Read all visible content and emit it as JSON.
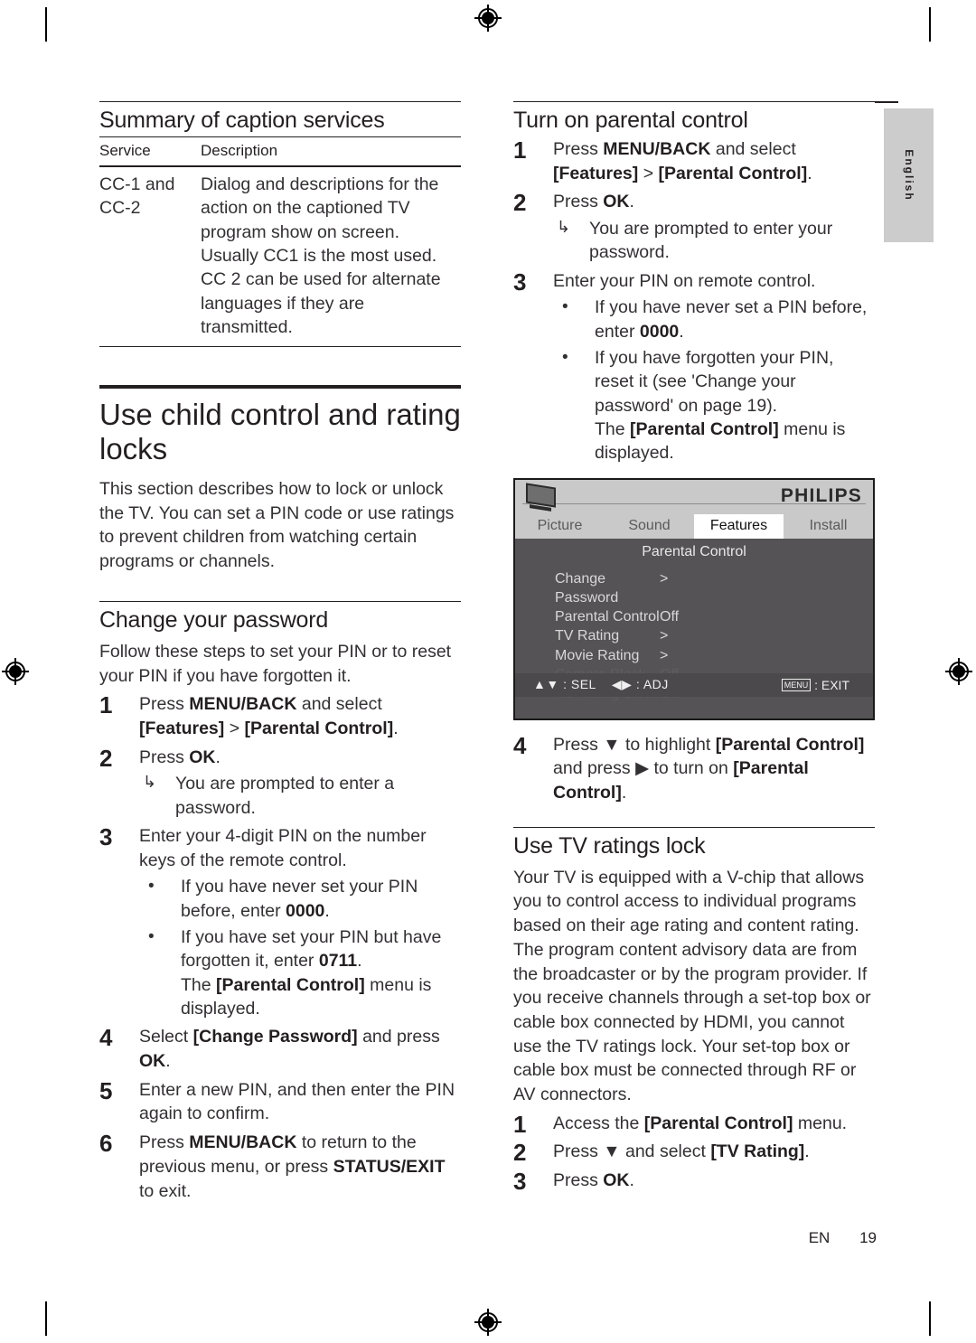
{
  "page": {
    "language_tab": "English",
    "footer_locale": "EN",
    "footer_page": "19"
  },
  "left_column": {
    "caption_section": {
      "heading": "Summary of caption services",
      "table": {
        "headers": [
          "Service",
          "Description"
        ],
        "rows": [
          {
            "service": "CC-1 and CC-2",
            "description": "Dialog and descriptions for the action on the captioned TV program show on screen. Usually CC1 is the most used. CC 2 can be used for alternate languages if they are transmitted."
          }
        ]
      }
    },
    "chapter": {
      "title": "Use child control and rating locks",
      "intro": "This section describes how to lock or unlock the TV. You can set a PIN code or use ratings to prevent children from watching certain programs or channels."
    },
    "change_password": {
      "heading": "Change your password",
      "intro": "Follow these steps to set your PIN or to reset your PIN if you have forgotten it.",
      "steps": [
        {
          "num": "1",
          "parts": [
            {
              "t": "Press ",
              "b": false
            },
            {
              "t": "MENU/BACK",
              "b": true
            },
            {
              "t": " and select ",
              "b": false
            },
            {
              "t": "[Features]",
              "b": true
            },
            {
              "t": " > ",
              "b": false
            },
            {
              "t": "[Parental Control]",
              "b": true
            },
            {
              "t": ".",
              "b": false
            }
          ]
        },
        {
          "num": "2",
          "parts": [
            {
              "t": "Press ",
              "b": false
            },
            {
              "t": "OK",
              "b": true
            },
            {
              "t": ".",
              "b": false
            }
          ],
          "result": "You are prompted to enter a password."
        },
        {
          "num": "3",
          "parts": [
            {
              "t": "Enter your 4-digit PIN on the number keys of the remote control.",
              "b": false
            }
          ],
          "bullets": [
            [
              {
                "t": "If you have never set your PIN before, enter ",
                "b": false
              },
              {
                "t": "0000",
                "b": true
              },
              {
                "t": ".",
                "b": false
              }
            ],
            [
              {
                "t": "If you have set your PIN but have forgotten it, enter ",
                "b": false
              },
              {
                "t": "0711",
                "b": true
              },
              {
                "t": ".",
                "b": false
              }
            ]
          ],
          "note": [
            {
              "t": "The ",
              "b": false
            },
            {
              "t": "[Parental Control]",
              "b": true
            },
            {
              "t": " menu is displayed.",
              "b": false
            }
          ]
        },
        {
          "num": "4",
          "parts": [
            {
              "t": "Select ",
              "b": false
            },
            {
              "t": "[Change Password]",
              "b": true
            },
            {
              "t": " and press ",
              "b": false
            },
            {
              "t": "OK",
              "b": true
            },
            {
              "t": ".",
              "b": false
            }
          ]
        },
        {
          "num": "5",
          "parts": [
            {
              "t": "Enter a new PIN, and then enter the PIN again to confirm.",
              "b": false
            }
          ]
        },
        {
          "num": "6",
          "parts": [
            {
              "t": "Press ",
              "b": false
            },
            {
              "t": "MENU/BACK",
              "b": true
            },
            {
              "t": " to return to the previous menu, or press ",
              "b": false
            },
            {
              "t": "STATUS/EXIT",
              "b": true
            },
            {
              "t": " to exit.",
              "b": false
            }
          ]
        }
      ]
    }
  },
  "right_column": {
    "turn_on": {
      "heading": "Turn on parental control",
      "steps": [
        {
          "num": "1",
          "parts": [
            {
              "t": "Press ",
              "b": false
            },
            {
              "t": "MENU/BACK",
              "b": true
            },
            {
              "t": " and select ",
              "b": false
            },
            {
              "t": "[Features]",
              "b": true
            },
            {
              "t": " > ",
              "b": false
            },
            {
              "t": "[Parental Control]",
              "b": true
            },
            {
              "t": ".",
              "b": false
            }
          ]
        },
        {
          "num": "2",
          "parts": [
            {
              "t": "Press ",
              "b": false
            },
            {
              "t": "OK",
              "b": true
            },
            {
              "t": ".",
              "b": false
            }
          ],
          "result": "You are prompted to enter your password."
        },
        {
          "num": "3",
          "parts": [
            {
              "t": "Enter your PIN on remote control.",
              "b": false
            }
          ],
          "bullets": [
            [
              {
                "t": "If you have never set a PIN before, enter ",
                "b": false
              },
              {
                "t": "0000",
                "b": true
              },
              {
                "t": ".",
                "b": false
              }
            ],
            [
              {
                "t": "If you have forgotten your PIN, reset it (see 'Change your password' on page 19).",
                "b": false
              }
            ]
          ],
          "note": [
            {
              "t": "The ",
              "b": false
            },
            {
              "t": "[Parental Control]",
              "b": true
            },
            {
              "t": " menu is displayed.",
              "b": false
            }
          ]
        }
      ],
      "step4": {
        "num": "4",
        "parts": [
          {
            "t": "Press ",
            "b": false
          },
          {
            "t": "▼",
            "b": false
          },
          {
            "t": " to highlight ",
            "b": false
          },
          {
            "t": "[Parental Control]",
            "b": true
          },
          {
            "t": " and press ",
            "b": false
          },
          {
            "t": "▶",
            "b": false
          },
          {
            "t": " to turn on ",
            "b": false
          },
          {
            "t": "[Parental Control]",
            "b": true
          },
          {
            "t": ".",
            "b": false
          }
        ]
      }
    },
    "tv_osd": {
      "brand": "PHILIPS",
      "tv_icon": "tv-icon",
      "tabs": [
        {
          "label": "Picture",
          "active": false
        },
        {
          "label": "Sound",
          "active": false
        },
        {
          "label": "Features",
          "active": true
        },
        {
          "label": "Install",
          "active": false
        }
      ],
      "menu_title": "Parental Control",
      "items": [
        {
          "label": "Change Password",
          "value": ">",
          "disabled": false
        },
        {
          "label": "Parental Control",
          "value": "Off",
          "disabled": false
        },
        {
          "label": "TV Rating",
          "value": ">",
          "disabled": false
        },
        {
          "label": "Movie Rating",
          "value": ">",
          "disabled": false
        },
        {
          "label": "Camera Block",
          "value": "Off",
          "disabled": true
        },
        {
          "label": "No Rating Block",
          "value": "Off",
          "disabled": true
        }
      ],
      "footer_left_sel": "▲▼ : SEL",
      "footer_left_adj": "◀▶ : ADJ",
      "footer_menu_key": "MENU",
      "footer_exit": ": EXIT"
    },
    "tv_ratings": {
      "heading": "Use TV ratings lock",
      "body": "Your TV is equipped with a V-chip that allows you to control access to individual programs based on their age rating and content rating. The program content advisory data are from the broadcaster or by the program provider. If you receive channels through a set-top box or cable box connected by HDMI, you cannot use the TV ratings lock. Your set-top box or cable box must be connected through RF or AV connectors.",
      "steps": [
        {
          "num": "1",
          "parts": [
            {
              "t": "Access the ",
              "b": false
            },
            {
              "t": "[Parental Control]",
              "b": true
            },
            {
              "t": " menu.",
              "b": false
            }
          ]
        },
        {
          "num": "2",
          "parts": [
            {
              "t": "Press ",
              "b": false
            },
            {
              "t": "▼",
              "b": false
            },
            {
              "t": " and select ",
              "b": false
            },
            {
              "t": "[TV Rating]",
              "b": true
            },
            {
              "t": ".",
              "b": false
            }
          ]
        },
        {
          "num": "3",
          "parts": [
            {
              "t": "Press ",
              "b": false
            },
            {
              "t": "OK",
              "b": true
            },
            {
              "t": ".",
              "b": false
            }
          ]
        }
      ]
    }
  }
}
